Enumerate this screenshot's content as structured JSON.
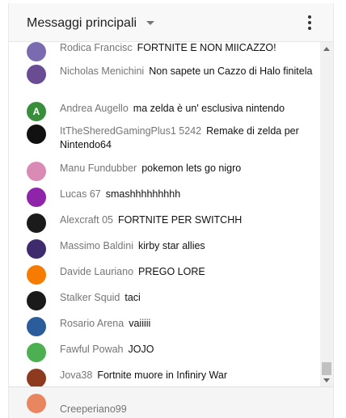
{
  "header": {
    "title": "Messaggi principali"
  },
  "messages": [
    {
      "author": "Rodica Francisc",
      "text": "FORTNITE E NON MIICAZZO!",
      "avatar_color": "#7a6bb0"
    },
    {
      "author": "Nicholas Menichini",
      "text": "Non sapete un Cazzo di Halo finitela",
      "avatar_color": "#6a4c93"
    },
    {
      "author": "Andrea Augello",
      "text": "ma zelda è un' esclusiva nintendo",
      "avatar_letter": "A",
      "avatar_color": "#388e3c"
    },
    {
      "author": "ItTheSheredGamingPlus1 5242",
      "text": "Remake di zelda per Nintendo64",
      "avatar_color": "#111111"
    },
    {
      "author": "Manu Fundubber",
      "text": "pokemon lets go nigro",
      "avatar_color": "#d98ab5"
    },
    {
      "author": "Lucas 67",
      "text": "smashhhhhhhhh",
      "avatar_color": "#8e24aa"
    },
    {
      "author": "Alexcraft 05",
      "text": "FORTNITE PER SWITCHH",
      "avatar_color": "#1b1b1b"
    },
    {
      "author": "Massimo Baldini",
      "text": "kirby star allies",
      "avatar_color": "#3d2b6e"
    },
    {
      "author": "Davide Lauriano",
      "text": "PREGO LORE",
      "avatar_color": "#f57c00"
    },
    {
      "author": "Stalker Squid",
      "text": "taci",
      "avatar_color": "#1a1a1a"
    },
    {
      "author": "Rosario Arena",
      "text": "vaiiiii",
      "avatar_color": "#2b5d9c"
    },
    {
      "author": "Fawful Powah",
      "text": "JOJO",
      "avatar_color": "#4caf50"
    },
    {
      "author": "Jova38",
      "text": "Fortnite muore in Infiniry War",
      "avatar_color": "#8d3a1f"
    }
  ],
  "footer": {
    "name": "Creeperiano99",
    "avatar_color": "#e8865f"
  }
}
